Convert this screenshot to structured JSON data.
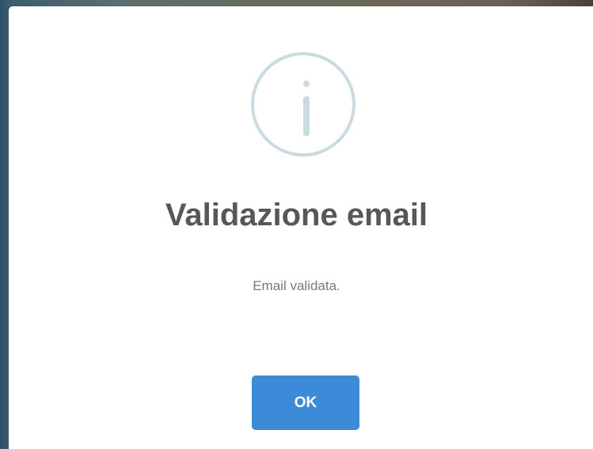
{
  "dialog": {
    "icon": "info-icon",
    "title": "Validazione email",
    "message": "Email validata.",
    "ok_label": "OK"
  },
  "colors": {
    "icon_stroke": "#c9dae1",
    "title_text": "#575757",
    "message_text": "#797979",
    "button_bg": "#3b8bd8",
    "button_text": "#ffffff"
  }
}
